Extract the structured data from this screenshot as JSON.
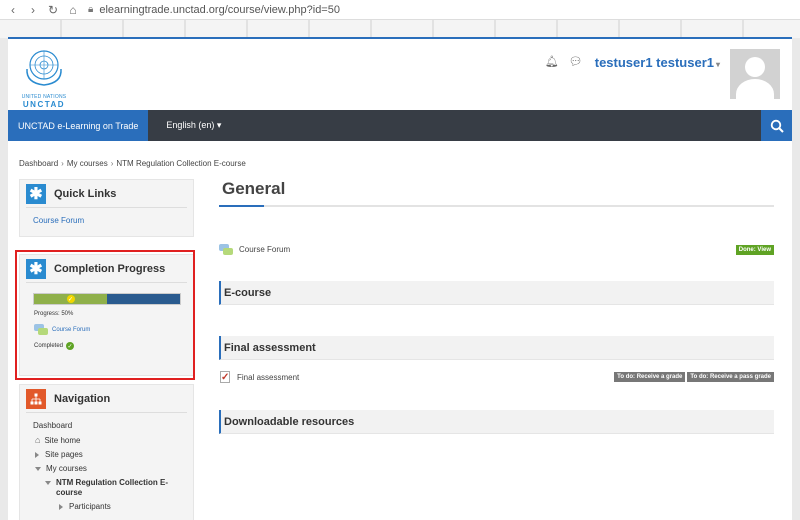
{
  "browser": {
    "url": "elearningtrade.unctad.org/course/view.php?id=50"
  },
  "header": {
    "logo_line1": "UNITED NATIONS",
    "logo_line2": "UNCTAD",
    "username": "testuser1 testuser1",
    "caret": "▾"
  },
  "navbar": {
    "brand": "UNCTAD e-Learning on Trade",
    "language": "English (en) ▾"
  },
  "breadcrumb": [
    "Dashboard",
    "My courses",
    "NTM Regulation Collection E-course"
  ],
  "quick_links": {
    "title": "Quick Links",
    "items": [
      "Course Forum"
    ]
  },
  "completion": {
    "title": "Completion Progress",
    "progress": 0.5,
    "progress_text": "Progress: 50%",
    "item_label": "Course Forum",
    "completed_text": "Completed"
  },
  "navigation": {
    "title": "Navigation",
    "items": [
      "Dashboard",
      "Site home",
      "Site pages",
      "My courses",
      "NTM Regulation Collection E-",
      "course",
      "Participants"
    ]
  },
  "main": {
    "title": "General",
    "forum_label": "Course Forum",
    "forum_status": "Done: View",
    "sections": [
      "E-course",
      "Final assessment",
      "Downloadable resources"
    ],
    "quiz_label": "Final assessment",
    "quiz_badge1": "To do: Receive a grade",
    "quiz_badge2": "To do: Receive a pass grade"
  },
  "colors": {
    "accent": "#2a6ebb",
    "navbar": "#373d45",
    "done": "#5fa324",
    "highlight": "#e02020"
  }
}
